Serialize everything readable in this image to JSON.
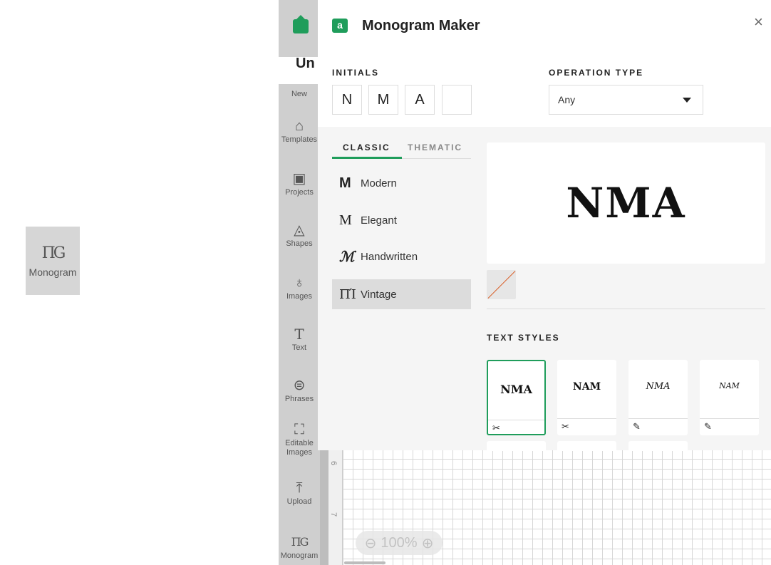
{
  "callout": {
    "icon": "monogram-icon",
    "icon_glyph": "ПG",
    "label": "Monogram"
  },
  "app": {
    "project_title": "Un",
    "home_icon": "home-icon",
    "accent_color": "#1f9d5b"
  },
  "leftnav": {
    "items": [
      {
        "label": "New",
        "icon": "new-icon",
        "glyph": ""
      },
      {
        "label": "Templates",
        "icon": "tshirt-icon",
        "glyph": "👕"
      },
      {
        "label": "Projects",
        "icon": "projects-icon",
        "glyph": "▣"
      },
      {
        "label": "Shapes",
        "icon": "shapes-icon",
        "glyph": "◬"
      },
      {
        "label": "Images",
        "icon": "lightbulb-icon",
        "glyph": "💡"
      },
      {
        "label": "Text",
        "icon": "text-icon",
        "glyph": "T"
      },
      {
        "label": "Phrases",
        "icon": "speech-bubble-icon",
        "glyph": "⊜"
      },
      {
        "label": "Editable Images",
        "icon": "editable-images-icon",
        "glyph": "⛶"
      },
      {
        "label": "Upload",
        "icon": "upload-icon",
        "glyph": "⤒"
      },
      {
        "label": "Monogram",
        "icon": "monogram-icon",
        "glyph": "ПG"
      }
    ]
  },
  "canvas": {
    "ruler_labels": [
      "6",
      "7"
    ],
    "zoom_label": "100%",
    "zoom_out": "⊖",
    "zoom_in": "⊕"
  },
  "modal": {
    "title": "Monogram Maker",
    "logo_letter": "a",
    "close": "×",
    "initials_label": "INITIALS",
    "initials": [
      "N",
      "M",
      "A",
      ""
    ],
    "operation_label": "OPERATION TYPE",
    "operation_value": "Any",
    "tabs": [
      "CLASSIC",
      "THEMATIC"
    ],
    "styles": [
      {
        "icon": "M",
        "label": "Modern"
      },
      {
        "icon": "M",
        "label": "Elegant"
      },
      {
        "icon": "ℳ",
        "label": "Handwritten"
      },
      {
        "icon": "ΠΊ",
        "label": "Vintage"
      }
    ],
    "preview_text": "NMA",
    "text_styles_label": "TEXT STYLES",
    "text_style_cards": [
      {
        "text": "NMA",
        "tool_icon": "scissors-icon",
        "tool_glyph": "✂"
      },
      {
        "text": "NAM",
        "tool_icon": "scissors-icon",
        "tool_glyph": "✂"
      },
      {
        "text": "NMA",
        "tool_icon": "pen-icon",
        "tool_glyph": "✎"
      },
      {
        "text": "NAM",
        "tool_icon": "pen-icon",
        "tool_glyph": "✎"
      }
    ]
  }
}
